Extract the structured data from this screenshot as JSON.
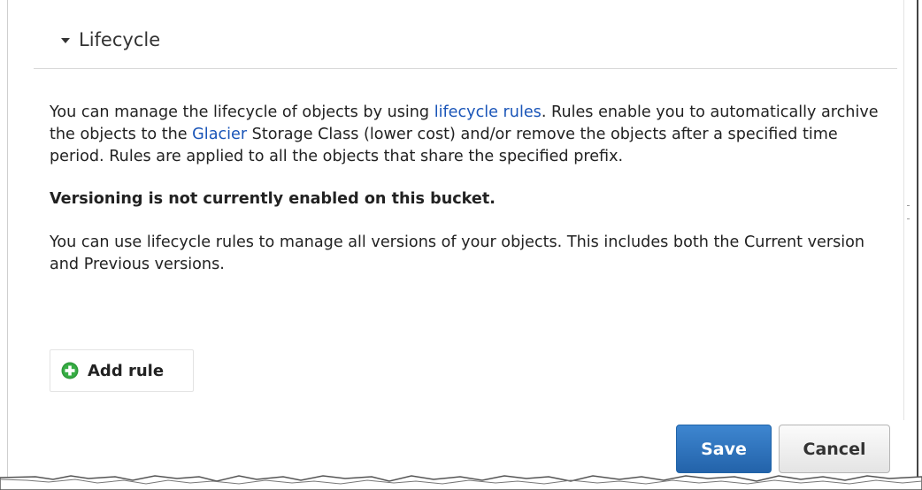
{
  "section": {
    "title": "Lifecycle",
    "icon": "caret-down-icon"
  },
  "content": {
    "p1_before_link1": "You can manage the lifecycle of objects by using ",
    "p1_link1": "lifecycle rules",
    "p1_between_links": ". Rules enable you to automatically archive the objects to the ",
    "p1_link2": "Glacier",
    "p1_after_link2": " Storage Class (lower cost) and/or remove the objects after a specified time period. Rules are applied to all the objects that share the specified prefix.",
    "versioning_notice": "Versioning is not currently enabled on this bucket.",
    "p3": "You can use lifecycle rules to manage all versions of your objects. This includes both the Current version and Previous versions."
  },
  "actions": {
    "add_rule_label": "Add rule",
    "add_rule_icon": "plus-circle-icon",
    "save_label": "Save",
    "cancel_label": "Cancel"
  },
  "colors": {
    "link": "#1a55b8",
    "primary_button": "#2f74bf",
    "add_icon": "#2e9a3a"
  }
}
